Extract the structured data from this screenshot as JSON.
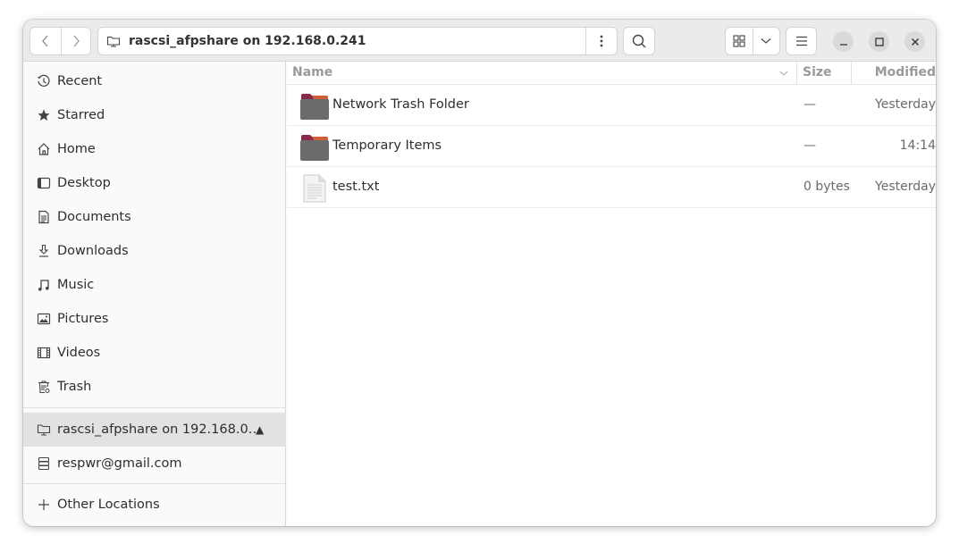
{
  "header": {
    "location": "rascsi_afpshare on 192.168.0.241",
    "back_icon": "chevron-left-icon",
    "forward_icon": "chevron-right-icon",
    "location_menu_icon": "vertical-ellipsis-icon",
    "search_icon": "search-icon",
    "view_icon": "grid-view-icon",
    "view_options_icon": "chevron-down-icon",
    "menu_icon": "hamburger-menu-icon",
    "window_controls": [
      "minimize",
      "maximize",
      "close"
    ]
  },
  "sidebar": {
    "places": [
      {
        "label": "Recent",
        "icon": "clock-icon"
      },
      {
        "label": "Starred",
        "icon": "star-icon"
      },
      {
        "label": "Home",
        "icon": "home-icon"
      },
      {
        "label": "Desktop",
        "icon": "desktop-icon"
      },
      {
        "label": "Documents",
        "icon": "document-icon"
      },
      {
        "label": "Downloads",
        "icon": "download-icon"
      },
      {
        "label": "Music",
        "icon": "music-icon"
      },
      {
        "label": "Pictures",
        "icon": "picture-icon"
      },
      {
        "label": "Videos",
        "icon": "video-icon"
      },
      {
        "label": "Trash",
        "icon": "trash-icon"
      }
    ],
    "mounts": [
      {
        "label": "rascsi_afpshare on 192.168.0…",
        "icon": "network-folder-icon",
        "active": true,
        "eject": "▲"
      },
      {
        "label": "respwr@gmail.com",
        "icon": "server-icon",
        "active": false
      }
    ],
    "other": {
      "label": "Other Locations",
      "icon": "plus-icon"
    }
  },
  "columns": {
    "name": "Name",
    "size": "Size",
    "modified": "Modified"
  },
  "files": [
    {
      "name": "Network Trash Folder",
      "type": "folder",
      "size": "—",
      "modified": "Yesterday"
    },
    {
      "name": "Temporary Items",
      "type": "folder",
      "size": "—",
      "modified": "14:14"
    },
    {
      "name": "test.txt",
      "type": "text",
      "size": "0 bytes",
      "modified": "Yesterday"
    }
  ],
  "colors": {
    "folder_body": "#6b6b6b",
    "folder_tab": "#8a2a4a",
    "folder_tab_edge": "#e06b2f"
  }
}
